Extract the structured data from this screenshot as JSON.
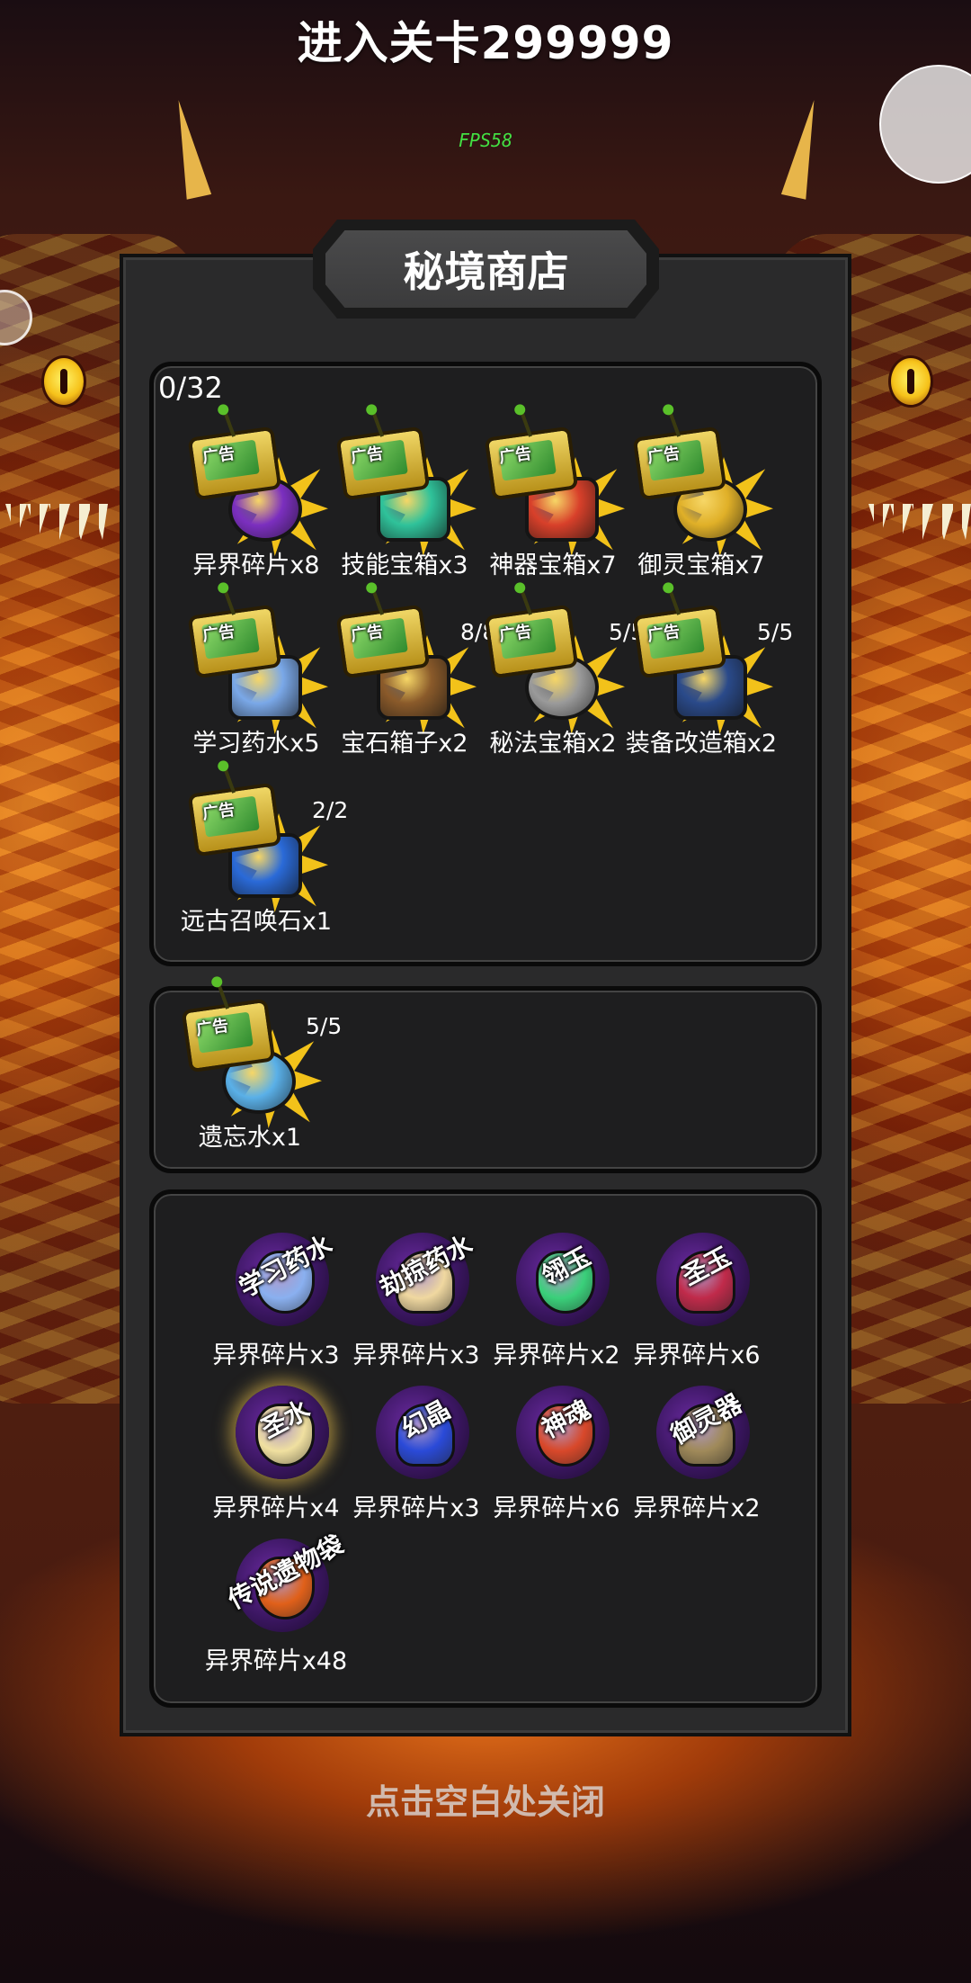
{
  "header": {
    "title": "进入关卡299999",
    "fps": "FPS58"
  },
  "shop": {
    "title": "秘境商店",
    "ad_counter": "0/32",
    "ad_badge": "广告",
    "ad_items": [
      {
        "name": "异界碎片x8",
        "limit": "",
        "icon": "purple-portal-icon",
        "color": "#7b2fbf"
      },
      {
        "name": "技能宝箱x3",
        "limit": "",
        "icon": "green-chest-icon",
        "color": "#2fc29a"
      },
      {
        "name": "神器宝箱x7",
        "limit": "",
        "icon": "red-chest-icon",
        "color": "#d8402a"
      },
      {
        "name": "御灵宝箱x7",
        "limit": "",
        "icon": "gold-chest-icon",
        "color": "#e0b028"
      },
      {
        "name": "学习药水x5",
        "limit": "",
        "icon": "blue-potion-icon",
        "color": "#7aa8e8"
      },
      {
        "name": "宝石箱子x2",
        "limit": "8/8",
        "icon": "gem-bag-icon",
        "color": "#8a5a2a"
      },
      {
        "name": "秘法宝箱x2",
        "limit": "5/5",
        "icon": "spell-book-icon",
        "color": "#9a9a9a"
      },
      {
        "name": "装备改造箱x2",
        "limit": "5/5",
        "icon": "equipment-box-icon",
        "color": "#2a4a8a"
      },
      {
        "name": "远古召唤石x1",
        "limit": "2/2",
        "icon": "summon-stone-icon",
        "color": "#2a6ad8"
      }
    ],
    "special_items": [
      {
        "name": "遗忘水x1",
        "limit": "5/5",
        "icon": "oblivion-crystal-icon",
        "color": "#5ab0e8"
      }
    ],
    "exchange_items": [
      {
        "label": "学习药水",
        "cost": "异界碎片x3",
        "icon": "learning-potion-icon",
        "color": "#8ab0f0"
      },
      {
        "label": "劫掠药水",
        "cost": "异界碎片x3",
        "icon": "plunder-potion-icon",
        "color": "#f0d8a0"
      },
      {
        "label": "翎玉",
        "cost": "异界碎片x2",
        "icon": "jade-icon",
        "color": "#3ad07a"
      },
      {
        "label": "圣玉",
        "cost": "异界碎片x6",
        "icon": "holy-jade-icon",
        "color": "#c02a4a"
      },
      {
        "label": "圣水",
        "cost": "异界碎片x4",
        "icon": "holy-water-icon",
        "color": "#f0e0a0"
      },
      {
        "label": "幻晶",
        "cost": "异界碎片x3",
        "icon": "phantom-crystal-icon",
        "color": "#2a4ad8"
      },
      {
        "label": "神魂",
        "cost": "异界碎片x6",
        "icon": "divine-soul-icon",
        "color": "#d8482a"
      },
      {
        "label": "御灵器",
        "cost": "异界碎片x2",
        "icon": "spirit-vessel-icon",
        "color": "#a08a5a"
      },
      {
        "label": "传说遗物袋",
        "cost": "异界碎片x48",
        "icon": "legendary-relic-bag-icon",
        "color": "#e0601a"
      }
    ],
    "close_hint": "点击空白处关闭"
  }
}
